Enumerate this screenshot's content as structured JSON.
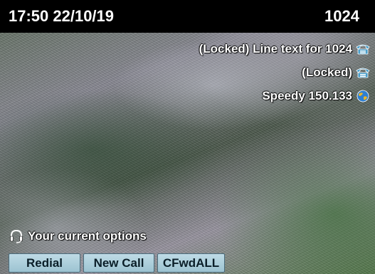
{
  "status_bar": {
    "datetime": "17:50 22/10/19",
    "extension": "1024"
  },
  "lines": [
    {
      "label": "(Locked) Line text for 1024",
      "icon": "phone-icon"
    },
    {
      "label": "(Locked)",
      "icon": "phone-icon"
    },
    {
      "label": "Speedy 150.133",
      "icon": "globe-icon"
    }
  ],
  "options": {
    "label": "Your current options",
    "icon": "headset-icon"
  },
  "softkeys": [
    {
      "label": "Redial"
    },
    {
      "label": "New Call"
    },
    {
      "label": "CFwdALL"
    }
  ],
  "colors": {
    "status_bar_bg": "#000000",
    "softkey_bg": "#aacfdc",
    "phone_icon": "#4a9ec9"
  }
}
